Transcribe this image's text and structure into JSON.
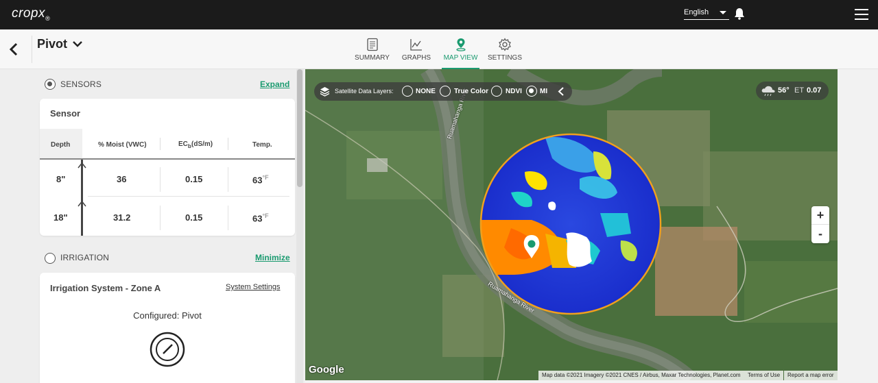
{
  "topbar": {
    "logo": "cropx",
    "logo_sub": "®",
    "language": "English"
  },
  "header": {
    "title": "Pivot",
    "tabs": [
      {
        "label": "SUMMARY"
      },
      {
        "label": "GRAPHS"
      },
      {
        "label": "MAP VIEW"
      },
      {
        "label": "SETTINGS"
      }
    ],
    "active_tab": "MAP VIEW"
  },
  "sensors": {
    "section_label": "SENSORS",
    "expand_label": "Expand",
    "card_title": "Sensor",
    "columns": {
      "depth": "Depth",
      "moist": "% Moist (VWC)",
      "ec_main": "EC",
      "ec_sub": "b",
      "ec_unit": "(dS/m)",
      "temp": "Temp."
    },
    "rows": [
      {
        "depth": "8\"",
        "moist": "36",
        "ec": "0.15",
        "temp": "63",
        "temp_unit": "°F"
      },
      {
        "depth": "18\"",
        "moist": "31.2",
        "ec": "0.15",
        "temp": "63",
        "temp_unit": "°F"
      }
    ]
  },
  "irrigation": {
    "section_label": "IRRIGATION",
    "minimize_label": "Minimize",
    "card_title": "Irrigation System - Zone A",
    "settings_link": "System Settings",
    "configured": "Configured: Pivot"
  },
  "map": {
    "layers_label": "Satellite Data Layers:",
    "layers": [
      {
        "label": "NONE",
        "selected": false
      },
      {
        "label": "True Color",
        "selected": false
      },
      {
        "label": "NDVI",
        "selected": false
      },
      {
        "label": "MI",
        "selected": true
      }
    ],
    "weather_temp": "56°",
    "weather_et_label": "ET",
    "weather_et_value": "0.07",
    "zoom_in": "+",
    "zoom_out": "-",
    "google": "Google",
    "river_label_1": "Ruamahanga River",
    "river_label_2": "Ruamahanga River",
    "attribution": "Map data ©2021 Imagery ©2021 CNES / Airbus, Maxar Technologies, Planet.com",
    "terms": "Terms of Use",
    "report": "Report a map error"
  },
  "colors": {
    "accent": "#1a9a6f",
    "topbar": "#1b1b1b",
    "pivot_ring": "#f0a01e",
    "heat_blue": "#1a2ecc",
    "heat_orange": "#ff8a00"
  }
}
